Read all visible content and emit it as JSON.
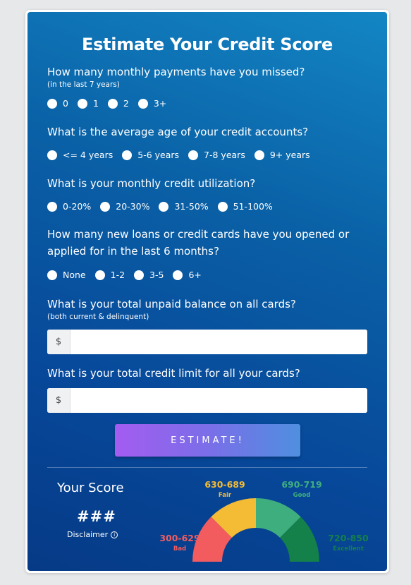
{
  "title": "Estimate Your Credit Score",
  "questions": {
    "missed": {
      "text": "How many monthly payments have you missed?",
      "sub": "(in the last 7 years)",
      "options": [
        "0",
        "1",
        "2",
        "3+"
      ]
    },
    "age": {
      "text": "What is the average age of your credit accounts?",
      "options": [
        "<= 4 years",
        "5-6 years",
        "7-8 years",
        "9+ years"
      ]
    },
    "utilization": {
      "text": "What is your monthly credit utilization?",
      "options": [
        "0-20%",
        "20-30%",
        "31-50%",
        "51-100%"
      ]
    },
    "new_credit": {
      "text": "How many new loans or credit cards have you opened or applied for in the last 6 months?",
      "options": [
        "None",
        "1-2",
        "3-5",
        "6+"
      ]
    },
    "balance": {
      "text": "What is your total unpaid balance on all cards?",
      "sub": "(both current & delinquent)",
      "prefix": "$",
      "value": ""
    },
    "limit": {
      "text": "What is your total credit limit for all your cards?",
      "prefix": "$",
      "value": ""
    }
  },
  "estimate_button": "ESTIMATE!",
  "result": {
    "heading": "Your Score",
    "score": "###",
    "disclaimer": "Disclaimer",
    "info_icon": "info-icon"
  },
  "gauge": {
    "bands": [
      {
        "range": "300-629",
        "label": "Bad",
        "color": "#f25c5f"
      },
      {
        "range": "630-689",
        "label": "Fair",
        "color": "#f4bb35"
      },
      {
        "range": "690-719",
        "label": "Good",
        "color": "#3fae7f"
      },
      {
        "range": "720-850",
        "label": "Excellent",
        "color": "#14804a"
      }
    ]
  }
}
